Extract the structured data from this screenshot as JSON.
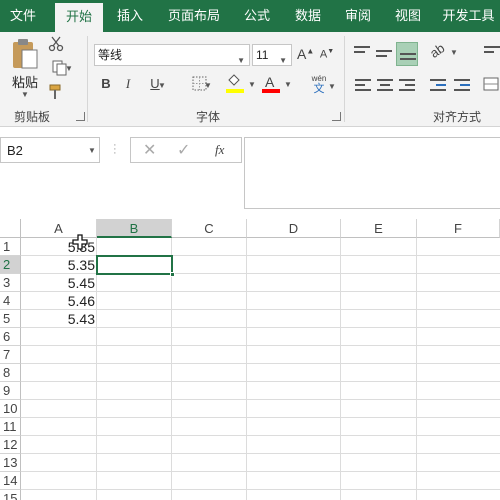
{
  "tabs": [
    "文件",
    "开始",
    "插入",
    "页面布局",
    "公式",
    "数据",
    "审阅",
    "视图",
    "开发工具"
  ],
  "ribbon": {
    "clipboard": {
      "paste_label": "粘贴",
      "group_label": "剪贴板"
    },
    "font": {
      "font_name": "等线",
      "font_size": "11",
      "bold": "B",
      "italic": "I",
      "underline": "U",
      "grow": "A",
      "shrink": "A",
      "font_color": "A",
      "phonetic_top": "wén",
      "phonetic_bottom": "文",
      "group_label": "字体",
      "highlight_color": "#ffff00",
      "font_color_value": "#ff0000"
    },
    "alignment": {
      "group_label": "对齐方式"
    }
  },
  "formula_bar": {
    "name_box": "B2",
    "fx_label": "fx",
    "formula": ""
  },
  "sheet": {
    "columns": [
      "A",
      "B",
      "C",
      "D",
      "E",
      "F"
    ],
    "rows": [
      "1",
      "2",
      "3",
      "4",
      "5",
      "6",
      "7",
      "8",
      "9",
      "10",
      "11",
      "12",
      "13",
      "14",
      "15"
    ],
    "values": [
      "5.35",
      "5.35",
      "5.45",
      "5.46",
      "5.43"
    ],
    "selected_cell": "B2"
  },
  "colors": {
    "brand": "#217346",
    "ribbon_bg": "#f3f3f3"
  }
}
